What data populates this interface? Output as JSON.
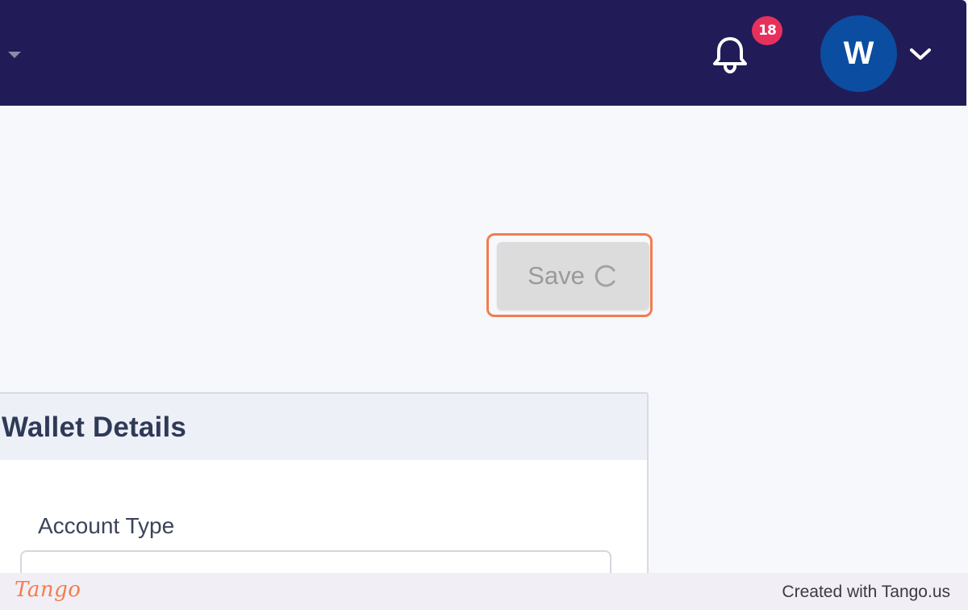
{
  "header": {
    "notification_count": "18",
    "avatar_initial": "W",
    "icons": [
      "caret-down-icon",
      "bell-icon",
      "chevron-down-icon"
    ],
    "colors": {
      "topbar": "#211c57",
      "badge": "#e8305d",
      "avatar": "#0b4da1"
    }
  },
  "actions": {
    "save_label": "Save",
    "save_state": "loading",
    "highlight_color": "#f27c50"
  },
  "wallet_card": {
    "title": "Wallet Details",
    "account_type_label": "Account Type",
    "account_type_value": ""
  },
  "footer": {
    "logo_text": "Tango",
    "credit": "Created with Tango.us"
  }
}
